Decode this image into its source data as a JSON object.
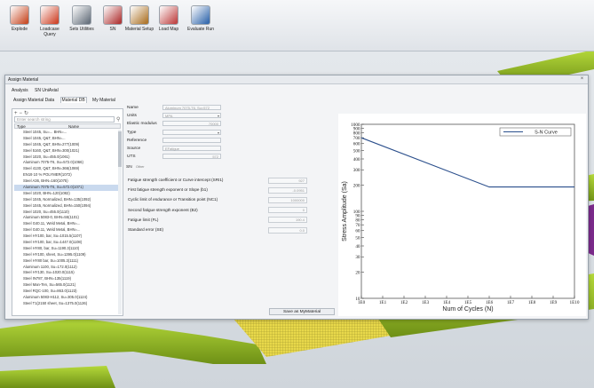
{
  "ribbon": {
    "buttons": [
      {
        "id": "explode",
        "label": "Explode",
        "icon": "explode-icon",
        "color": "#c94f2b"
      },
      {
        "id": "loadcase-query",
        "label": "Loadcase Query",
        "icon": "loadcase-query-icon",
        "color": "#d0492f"
      },
      {
        "id": "sets-utilities",
        "label": "Sets Utilities",
        "icon": "sets-utilities-icon",
        "color": "#6a7480"
      },
      {
        "id": "sn",
        "label": "SN",
        "icon": "sn-icon",
        "color": "#b23a3a"
      },
      {
        "id": "material-setup",
        "label": "Material Setup",
        "icon": "material-setup-icon",
        "color": "#b0782f"
      },
      {
        "id": "load-map",
        "label": "Load Map",
        "icon": "load-map-icon",
        "color": "#c24a4a"
      },
      {
        "id": "evaluate-run",
        "label": "Evaluate Run",
        "icon": "evaluate-run-icon",
        "color": "#3a6db0"
      }
    ]
  },
  "dialog": {
    "title": "Assign Material",
    "tabs": [
      "Analysis",
      "SN UniAxial"
    ],
    "subtabs": [
      "Assign Material Data",
      "Material DB",
      "My Material"
    ],
    "active_subtab": 1,
    "search_placeholder": "Enter search string",
    "columns": [
      "Type",
      "Name"
    ],
    "materials": [
      "Steel 1045, Su=... BHN=...",
      "Steel 1045, Q&T, BHN=...",
      "Steel 1045, Q&T, BHN=277(1009)",
      "Steel 5160, Q&T, BHN=300(1021)",
      "Steel 1020, Su=455.0(1061)",
      "Aluminum 7075-T6, Su=572.0(1066)",
      "Steel 4130, Q&T, BHN=366(1069)",
      "EN19 10 % POLYMER(1072)",
      "Steel A36, BHN=160(1075)",
      "Aluminum 7075-T6, Su=572.0(1071)",
      "Steel 1020, BHN=120(1082)",
      "Steel 1045, Normalized, BHN=135(1092)",
      "Steel 1045, Normalized, BHN=150(1094)",
      "Steel 1020, Su=455.0(1110)",
      "Aluminum 5083-0, BHN=55(1101)",
      "Steel G40.11, Weld Metal, BHN=...",
      "Steel G40.11, Weld Metal, BHN=...",
      "Steel HY100, bar, Su=1015.5(1107)",
      "Steel HY100, bar, Su=1447.0(1108)",
      "Steel HY80, bar, Su=1190.3(1110)",
      "Steel HY100, sheet, Su=1395.0(1109)",
      "Steel HY80 bar, Su=1005.3(1111)",
      "Aluminum 1100, Su=172.0(1112)",
      "Steel HY130, Su=1020.0(1115)",
      "Steel IN787, BHN=135(1119)",
      "Steel Man-Ten, Su=565.0(1121)",
      "Steel RQC-100, Su=863.0(1123)",
      "Aluminum 5083-H112, Su=305.0(1124)",
      "Steel T1(2150 sheet, Su=1375.0(1126)"
    ],
    "selected_index": 9,
    "properties": [
      {
        "label": "Name",
        "value": "Aluminum 7075-T6, Su=572",
        "kind": "text"
      },
      {
        "label": "Units",
        "value": "MPA",
        "kind": "dropdown"
      },
      {
        "label": "Elastic modulus",
        "value": "70000",
        "kind": "number"
      },
      {
        "label": "Type",
        "value": "",
        "kind": "dropdown"
      },
      {
        "label": "Reference",
        "value": "",
        "kind": "text"
      },
      {
        "label": "Source",
        "value": "EFatigue",
        "kind": "text"
      },
      {
        "label": "UTS",
        "value": "572",
        "kind": "number"
      }
    ],
    "sn_section_label": "SN",
    "sn_section_extra": "Other",
    "sn_params": [
      {
        "label": "Fatigue strength coefficient or Curve intercept (SRI1)",
        "value": "927"
      },
      {
        "label": "First fatigue strength exponent or Slope (b1)",
        "value": "-0.0951"
      },
      {
        "label": "Cyclic limit of endurance or Transition point (NC1)",
        "value": "1000000"
      },
      {
        "label": "Second fatigue strength exponent (B2)",
        "value": "0"
      },
      {
        "label": "Fatigue limit (FL)",
        "value": "190.4"
      },
      {
        "label": "Standard error (SE)",
        "value": "0.0"
      }
    ],
    "save_button": "Save as MyMaterial",
    "close_glyph": "×"
  },
  "chart_data": {
    "type": "line",
    "legend_placement": "top-right",
    "xlabel": "Num of Cycles (N)",
    "ylabel": "Stress Amplitude (Sa)",
    "x_scale": "log",
    "y_scale": "log",
    "xlim": [
      1,
      10000000000
    ],
    "ylim": [
      10,
      1000
    ],
    "x_ticks": [
      {
        "v": 1,
        "label": "1E0"
      },
      {
        "v": 10,
        "label": "1E1"
      },
      {
        "v": 100,
        "label": "1E2"
      },
      {
        "v": 1000,
        "label": "1E3"
      },
      {
        "v": 10000,
        "label": "1E4"
      },
      {
        "v": 100000,
        "label": "1E5"
      },
      {
        "v": 1000000,
        "label": "1E6"
      },
      {
        "v": 10000000,
        "label": "1E7"
      },
      {
        "v": 100000000,
        "label": "1E8"
      },
      {
        "v": 1000000000,
        "label": "1E9"
      },
      {
        "v": 10000000000,
        "label": "1E10"
      }
    ],
    "y_ticks": [
      1000,
      900,
      800,
      700,
      600,
      500,
      400,
      300,
      200,
      100,
      90,
      80,
      70,
      60,
      50,
      40,
      30,
      20,
      10
    ],
    "series": [
      {
        "name": "S-N Curve",
        "color": "#2b4f8c",
        "x": [
          1,
          1000000,
          10000000000
        ],
        "y": [
          700,
          190.4,
          190.4
        ]
      }
    ],
    "grid": false
  },
  "viewport": {
    "model_color": "#9cc321",
    "mesh_color": "#e8d84a",
    "accent_color": "#7b2a8a"
  }
}
